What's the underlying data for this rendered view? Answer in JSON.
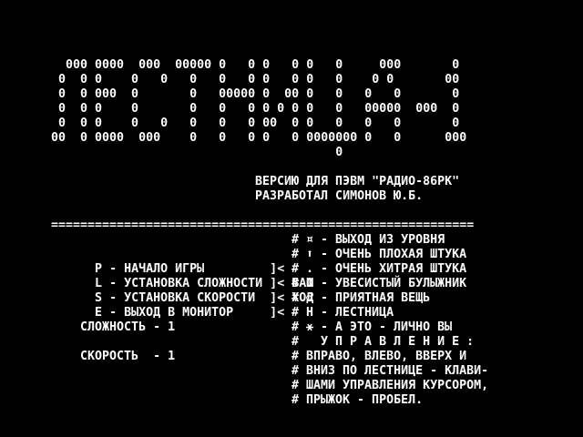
{
  "title_logo": [
    "  000 0000  000  00000 0   0 0   0 0   0     000       0",
    " 0  0 0    0   0   0   0   0 0   0 0   0    0 0       00",
    " 0  0 000  0       0   00000 0  00 0   0   0   0       0",
    " 0  0 0    0       0   0   0 0 0 0 0   0   00000  000  0",
    " 0  0 0    0   0   0   0   0 00  0 0   0   0   0       0",
    "00  0 0000  000    0   0   0 0   0 0000000 0   0      000",
    "                                       0"
  ],
  "credits": {
    "line1": "ВЕРСИЮ ДЛЯ ПЭВМ \"РАДИО-86РК\"",
    "line2": "РАЗРАБОТАЛ СИМОНОВ Ю.Б."
  },
  "separator": "==========================================================",
  "menu": [
    {
      "key": "P",
      "text": " - НАЧАЛО ИГРЫ         ]<",
      "hint": ""
    },
    {
      "key": "L",
      "text": " - УСТАНОВКА СЛОЖНОСТИ ]<",
      "hint": " ВАШ"
    },
    {
      "key": "S",
      "text": " - УСТАНОВКА СКОРОСТИ  ]<",
      "hint": " ХОД"
    },
    {
      "key": "E",
      "text": " - ВЫХОД В МОНИТОР     ]<",
      "hint": ""
    }
  ],
  "settings": {
    "difficulty": "    СЛОЖНОСТЬ - 1",
    "speed": "    СКОРОСТЬ  - 1"
  },
  "legend": [
    "# ¤ - ВЫХОД ИЗ УРОВНЯ",
    "# ⬆ - ОЧЕНЬ ПЛОХАЯ ШТУКА",
    "# . - ОЧЕНЬ ХИТРАЯ ШТУКА",
    "# 0 - УВЕСИСТЫЙ БУЛЫЖНИК",
    "# ♂ - ПРИЯТНАЯ ВЕЩЬ",
    "# Н - ЛЕСТНИЦА",
    "# ⚹ - А ЭТО - ЛИЧНО ВЫ",
    "#   У П Р А В Л Е Н И Е :",
    "# ВПРАВО, ВЛЕВО, ВВЕРХ И",
    "# ВНИЗ ПО ЛЕСТНИЦЕ - КЛАВИ-",
    "# ШАМИ УПРАВЛЕНИЯ КУРСОРОМ,",
    "# ПРЫЖОК - ПРОБЕЛ."
  ],
  "colors": {
    "background": "#000000",
    "foreground": "#ffffff"
  }
}
